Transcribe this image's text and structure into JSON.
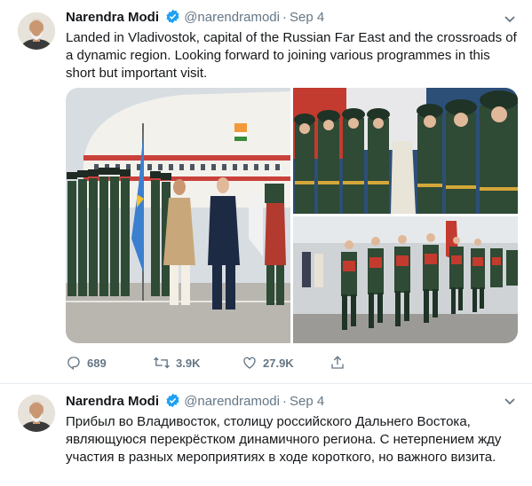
{
  "tweets": [
    {
      "author": "Narendra Modi",
      "handle": "@narendramodi",
      "separator": "·",
      "date": "Sep 4",
      "text": "Landed in Vladivostok, capital of the Russian Far East and the crossroads of a dynamic region. Looking forward to joining various programmes in this short but important visit.",
      "actions": {
        "replies": "689",
        "retweets": "3.9K",
        "likes": "27.9K"
      },
      "photos": [
        {
          "icon": "photo-airport-guard-of-honour"
        },
        {
          "icon": "photo-soldiers-close-up"
        },
        {
          "icon": "photo-soldiers-marching"
        }
      ]
    },
    {
      "author": "Narendra Modi",
      "handle": "@narendramodi",
      "separator": "·",
      "date": "Sep 4",
      "text": "Прибыл во Владивосток, столицу российского Дальнего Востока, являющуюся перекрёстком динамичного региона. С нетерпением жду участия в разных мероприятиях в ходе короткого, но важного визита."
    }
  ],
  "colors": {
    "text": "#14171a",
    "secondary": "#657786",
    "verified": "#1da1f2",
    "divider": "#e6ecf0",
    "guard_uniform": "#2f4a35",
    "guard_red": "#c0392b"
  }
}
